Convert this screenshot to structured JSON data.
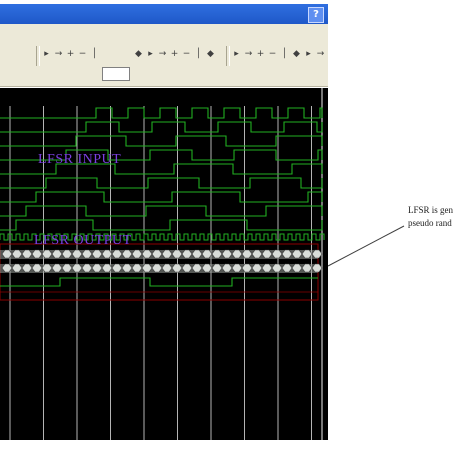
{
  "window": {
    "help_glyph": "?"
  },
  "toolbar": {
    "icons": [
      {
        "name": "run-icon",
        "glyph": "▸"
      },
      {
        "name": "step-icon",
        "glyph": "→"
      },
      {
        "name": "zoom-in-icon",
        "glyph": "+"
      },
      {
        "name": "zoom-out-icon",
        "glyph": "−"
      },
      {
        "name": "cursor-icon",
        "glyph": "│"
      },
      {
        "name": "marker-icon",
        "glyph": "◆"
      }
    ]
  },
  "waveform": {
    "input_label": "LFSR INPUT",
    "output_label": "LFSR OUTPUT",
    "colors": {
      "background": "#000000",
      "signal": "#22b022",
      "grid": "#c8c8c8",
      "bus_fill": "#9aa09a",
      "label": "#7b3fe0",
      "marker": "#8b0000"
    }
  },
  "annotation": {
    "line1": "LFSR is gen",
    "line2": "pseudo rand"
  }
}
